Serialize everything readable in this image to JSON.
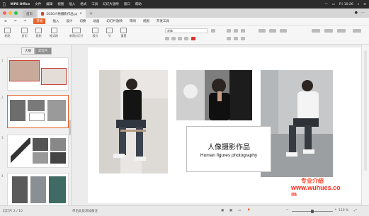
{
  "menubar": {
    "app": "WPS Office",
    "items": [
      "文件",
      "编辑",
      "视图",
      "插入",
      "格式",
      "工具",
      "幻灯片放映",
      "窗口",
      "帮助"
    ],
    "clock": "Fri 10:26"
  },
  "tabs": [
    {
      "label": "首页"
    },
    {
      "label": "2020人物摄影作品.pptx"
    }
  ],
  "ribbon_tabs": {
    "items": [
      "开始",
      "插入",
      "设计",
      "切换",
      "动画",
      "幻灯片放映",
      "审阅",
      "视图",
      "开发工具"
    ],
    "active_index": 0
  },
  "toolbar": {
    "font_name": "宋体",
    "buttons": [
      "粘贴",
      "剪切",
      "复制",
      "格式刷",
      "新建幻灯片",
      "版式",
      "节",
      "重置"
    ]
  },
  "left_pane": {
    "tabs": [
      "大纲",
      "幻灯片"
    ],
    "selected_tab": 1,
    "slide_numbers": [
      "1",
      "2",
      "3",
      "4"
    ],
    "selected_slide": 2
  },
  "slide": {
    "title_cn": "人像摄影作品",
    "title_en": "Human figures photography",
    "watermark_cn": "专业介绍",
    "watermark_url_line1": "www.wuhues.co",
    "watermark_url_line2": "m"
  },
  "statusbar": {
    "slide_info": "幻灯片 2 / 10",
    "notes_label": "单击此处添加备注",
    "zoom": "110 %",
    "zoom_level": 0.5
  },
  "colors": {
    "accent": "#e8632b",
    "watermark": "#ff2a1a",
    "menubar_bg": "#2b2b2b"
  }
}
